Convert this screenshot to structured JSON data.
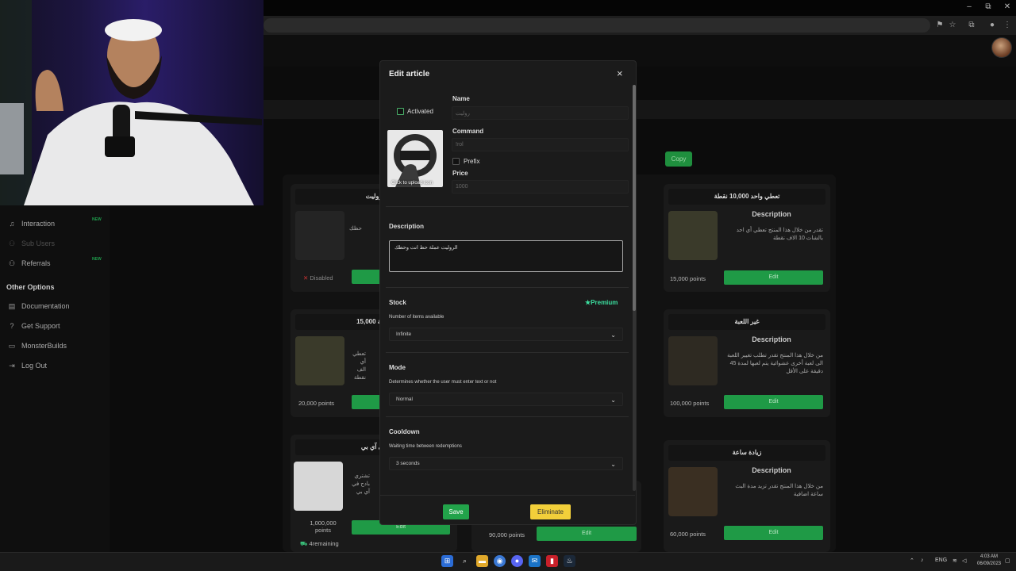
{
  "browser": {
    "window_controls": [
      "–",
      "⧉",
      "✕"
    ],
    "icons": [
      "translate-icon",
      "star-icon",
      "extensions-icon",
      "profile-icon",
      "menu-icon"
    ]
  },
  "sidebar": {
    "items": [
      {
        "label": "Interaction",
        "icon": "music-icon",
        "badge": "NEW"
      },
      {
        "label": "Sub Users",
        "icon": "users-icon",
        "badge": ""
      },
      {
        "label": "Referrals",
        "icon": "users-icon",
        "badge": "NEW"
      }
    ],
    "other_heading": "Other Options",
    "other_items": [
      {
        "label": "Documentation",
        "icon": "book-icon"
      },
      {
        "label": "Get Support",
        "icon": "help-icon"
      },
      {
        "label": "MonsterBuilds",
        "icon": "monitor-icon"
      },
      {
        "label": "Log Out",
        "icon": "logout-icon"
      }
    ]
  },
  "page": {
    "copy_label": "Copy"
  },
  "cards": [
    {
      "title": "روليت",
      "status": "Disabled",
      "desc_partial": "حظك"
    },
    {
      "title": "تعطي واحد 10,000 نقطة",
      "desc_heading": "Description",
      "desc": "تقدر من خلال هذا المنتج تعطي أي احد بالشات 10 الاف نقطة",
      "points": "15,000 points",
      "edit": "Edit"
    },
    {
      "title": "15,000 نقطة",
      "desc_partial": "تعطي أي الف نقطة",
      "points": "20,000 points"
    },
    {
      "title": "غير اللعبة",
      "desc_heading": "Description",
      "desc": "من خلال هذا المنتج تقدر تطلب تغيير اللعبة الى لعبة أخرى عشوائية يتم لعبها لمدة 45 دقيقة على الأقل",
      "points": "100,000 points",
      "edit": "Edit"
    },
    {
      "title": "في آي بي",
      "desc_partial": "تشتري بادج في آي بي",
      "points": "1,000,000 points",
      "remaining": "4remaining",
      "edit": "Edit"
    },
    {
      "title": "",
      "points": "90,000 points",
      "edit": "Edit"
    },
    {
      "title": "زيادة ساعة",
      "desc_heading": "Description",
      "desc": "من خلال هذا المنتج تقدر تزيد مدة البث ساعة اضافية",
      "points": "60,000 points",
      "edit": "Edit"
    }
  ],
  "modal": {
    "title": "Edit article",
    "close": "×",
    "activated_label": "Activated",
    "icon_caption": "Click to upload icon",
    "name_label": "Name",
    "name_value": "روليت",
    "command_label": "Command",
    "command_value": "!rol",
    "prefix_label": "Prefix",
    "price_label": "Price",
    "price_value": "1000",
    "description_label": "Description",
    "description_value": "الروليت عملة حظ انت وحظك",
    "stock": {
      "label": "Stock",
      "premium": "Premium",
      "sub": "Number of items available",
      "value": "Infinite"
    },
    "mode": {
      "label": "Mode",
      "sub": "Determines whether the user must enter text or not",
      "value": "Normal"
    },
    "cooldown": {
      "label": "Cooldown",
      "sub": "Waiting time between redemptions",
      "value": "3 seconds"
    },
    "save_label": "Save",
    "eliminate_label": "Eliminate",
    "colors": {
      "save": "#22a34a",
      "eliminate": "#f2cf3a",
      "premium": "#3ce0a0"
    }
  },
  "taskbar": {
    "lang": "ENG",
    "time": "4:03 AM",
    "date": "06/09/2023",
    "apps": [
      "windows-icon",
      "search-icon",
      "files-icon",
      "chrome-icon",
      "discord-icon",
      "outlook-icon",
      "app-icon",
      "steam-icon"
    ]
  }
}
